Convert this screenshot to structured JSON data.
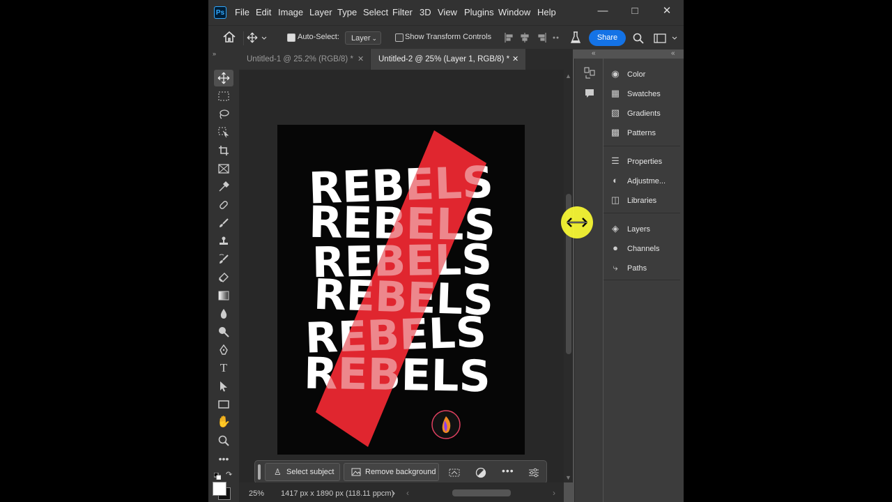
{
  "app": {
    "logo": "Ps"
  },
  "menubar": {
    "items": [
      "File",
      "Edit",
      "Image",
      "Layer",
      "Type",
      "Select",
      "Filter",
      "3D",
      "View",
      "Plugins",
      "Window",
      "Help"
    ],
    "window_controls": [
      "minimize-icon",
      "maximize-icon",
      "close-icon"
    ]
  },
  "options": {
    "auto_select_label": "Auto-Select:",
    "auto_select_checked": true,
    "layer_dropdown": "Layer",
    "show_transform_label": "Show Transform Controls",
    "share_label": "Share"
  },
  "tabs": [
    {
      "label": "Untitled-1 @ 25.2% (RGB/8) *",
      "active": false
    },
    {
      "label": "Untitled-2 @ 25% (Layer 1, RGB/8) *",
      "active": true
    }
  ],
  "toolbar": {
    "tools": [
      "move-tool-icon",
      "marquee-tool-icon",
      "lasso-tool-icon",
      "object-select-tool-icon",
      "crop-tool-icon",
      "frame-tool-icon",
      "eyedropper-tool-icon",
      "healing-brush-icon",
      "brush-tool-icon",
      "clone-stamp-icon",
      "history-brush-icon",
      "eraser-tool-icon",
      "gradient-tool-icon",
      "blur-tool-icon",
      "dodge-tool-icon",
      "pen-tool-icon",
      "type-tool-icon",
      "path-select-icon",
      "rectangle-tool-icon",
      "hand-tool-icon",
      "zoom-tool-icon",
      "more-tools-icon"
    ]
  },
  "canvas": {
    "artwork_text": "REBELS",
    "colors": {
      "background": "#060606",
      "accent": "#e0262f",
      "text": "#ffffff"
    }
  },
  "contextual_bar": {
    "select_subject": "Select subject",
    "remove_background": "Remove background"
  },
  "status": {
    "zoom": "25%",
    "dimensions": "1417 px x 1890 px (118.11 ppcm)"
  },
  "panels": {
    "group1": [
      {
        "label": "Color",
        "icon": "palette-icon"
      },
      {
        "label": "Swatches",
        "icon": "grid-icon"
      },
      {
        "label": "Gradients",
        "icon": "gradient-icon"
      },
      {
        "label": "Patterns",
        "icon": "pattern-icon"
      }
    ],
    "group2": [
      {
        "label": "Properties",
        "icon": "sliders-icon"
      },
      {
        "label": "Adjustme...",
        "icon": "adjustment-icon"
      },
      {
        "label": "Libraries",
        "icon": "library-icon"
      }
    ],
    "group3": [
      {
        "label": "Layers",
        "icon": "layers-icon"
      },
      {
        "label": "Channels",
        "icon": "channels-icon"
      },
      {
        "label": "Paths",
        "icon": "paths-icon"
      }
    ]
  }
}
